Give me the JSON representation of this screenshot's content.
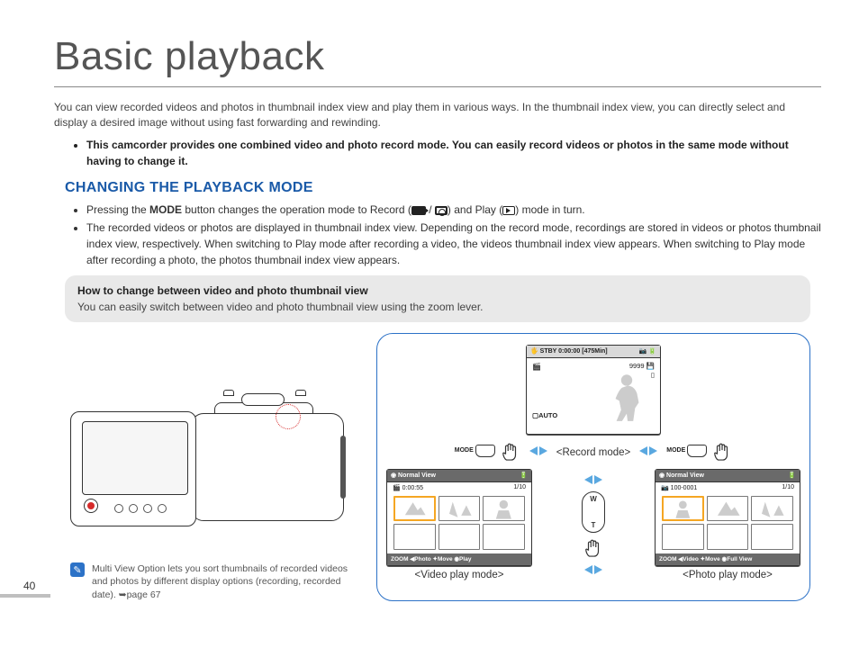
{
  "page_number": "40",
  "title": "Basic playback",
  "intro": "You can view recorded videos and photos in thumbnail index view and play them in various ways. In the thumbnail index view, you can directly select and display a desired image without using fast forwarding and rewinding.",
  "key_point": "This camcorder provides one combined video and photo record mode. You can easily record videos or photos in the same mode without having to change it.",
  "section_heading": "CHANGING THE PLAYBACK MODE",
  "mode_bullet_1a": "Pressing the ",
  "mode_bullet_1b": "MODE",
  "mode_bullet_1c": " button changes the operation mode to Record (",
  "mode_bullet_1d": " / ",
  "mode_bullet_1e": ") and Play (",
  "mode_bullet_1f": ") mode in turn.",
  "mode_bullet_2": "The recorded videos or photos are displayed in thumbnail index view. Depending on the record mode, recordings are stored in videos or photos thumbnail index view, respectively. When switching to Play mode after recording a video, the videos thumbnail index view appears. When switching to Play mode after recording a photo, the photos thumbnail index view appears.",
  "howto_title": "How to change between video and photo thumbnail view",
  "howto_body": "You can easily switch between video and photo thumbnail view using the zoom lever.",
  "note_text": "Multi View Option lets you sort thumbnails of recorded videos and photos by different display options (recording, recorded date). ➥page 67",
  "diagram": {
    "record_caption": "<Record mode>",
    "video_caption": "<Video play mode>",
    "photo_caption": "<Photo play mode>",
    "mode_label": "MODE",
    "record_top_left": "STBY 0:00:00 [475Min]",
    "record_info_count": "9999",
    "record_auto": "▢AUTO",
    "video_header": "◉ Normal View",
    "video_page": "1/10",
    "video_code": "0:00:55",
    "photo_header": "◉ Normal View",
    "photo_page": "1/10",
    "photo_code": "100-0001",
    "footer_photo": "ZOOM ◀Photo   ✦Move   ◉Play",
    "footer_video": "ZOOM ◀Video   ✦Move   ◉Full View"
  }
}
